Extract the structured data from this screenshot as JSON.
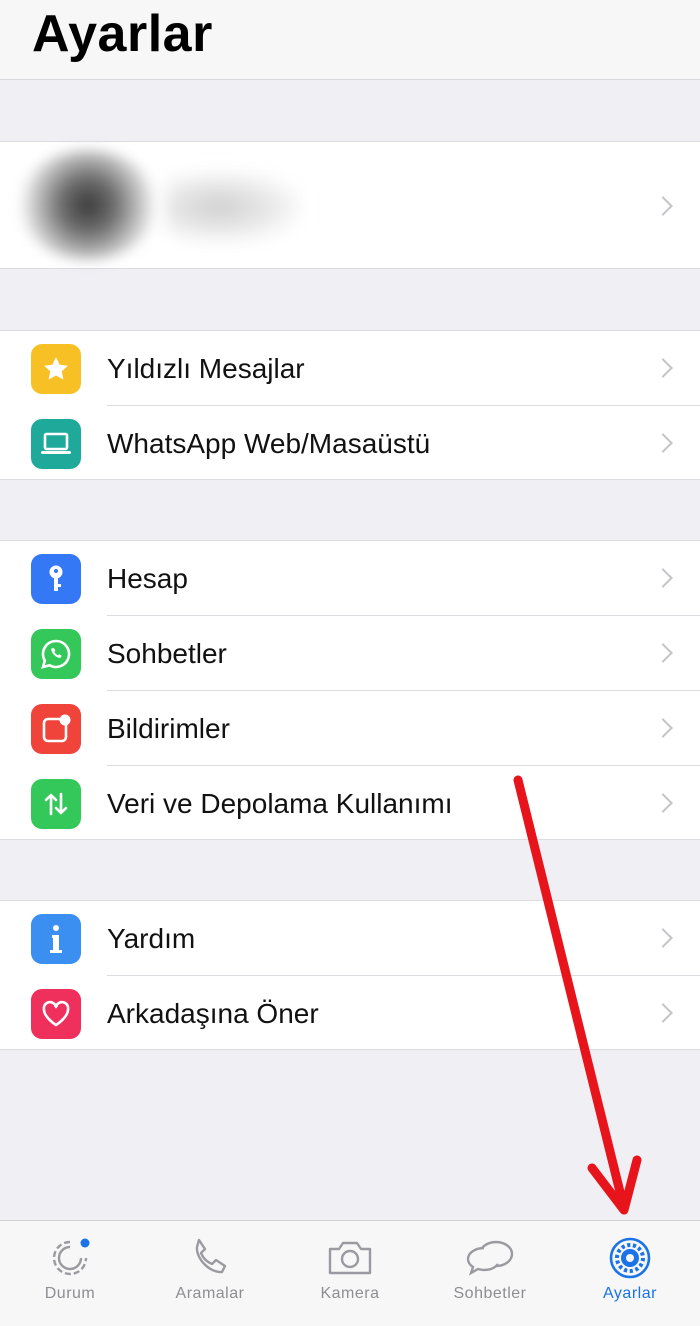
{
  "header": {
    "title": "Ayarlar"
  },
  "sections": {
    "starred": {
      "label": "Yıldızlı Mesajlar",
      "color": "#f7c025"
    },
    "web": {
      "label": "WhatsApp Web/Masaüstü",
      "color": "#1fa99a"
    },
    "account": {
      "label": "Hesap",
      "color": "#3478f6"
    },
    "chats": {
      "label": "Sohbetler",
      "color": "#34c759"
    },
    "notifications": {
      "label": "Bildirimler",
      "color": "#f0433a"
    },
    "data": {
      "label": "Veri ve Depolama Kullanımı",
      "color": "#34c759"
    },
    "help": {
      "label": "Yardım",
      "color": "#3a8ff0"
    },
    "invite": {
      "label": "Arkadaşına Öner",
      "color": "#f0305c"
    }
  },
  "tabbar": {
    "status": "Durum",
    "calls": "Aramalar",
    "camera": "Kamera",
    "chats": "Sohbetler",
    "settings": "Ayarlar",
    "active_color": "#1a73e8",
    "inactive_color": "#8e8e93"
  },
  "annotation": {
    "arrow_color": "#e8141c"
  }
}
